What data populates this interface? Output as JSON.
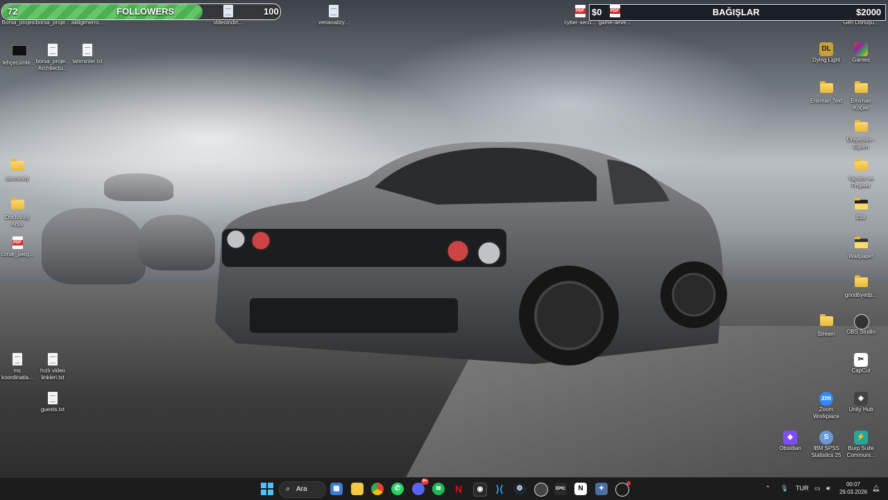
{
  "overlays": {
    "followers": {
      "current": "72",
      "label": "FOLLOWERS",
      "goal": "100",
      "progress": 0.72
    },
    "donations": {
      "current": "$0",
      "label": "BAĞIŞLAR",
      "goal": "$2000"
    }
  },
  "desktop_icons": {
    "borsa_projesi": "Borsa_projesi",
    "borsa_proje": "borsa_proje...",
    "aldigimerro": "aldigimerro...",
    "videoindin": "videoindin...",
    "verianalizy": "verianalizy...",
    "cyber_secu": "cyber-secu...",
    "game_deve": "game-deve...",
    "geri_donusu": "Geri Dönüşü...",
    "lehcecumle": "lehçecümle...",
    "borsa_architectu": "borsa_proje... Architectu...",
    "tahminler": "tahminler.txt",
    "dying_light": "Dying Light",
    "games": "Games",
    "emirhan_text": "Emirhan Text",
    "emirhan_kocak": "Emirhan Koçak",
    "universite": "Üniversite - Eğitim",
    "docminify": "docminify",
    "yazilim": "Yazılım ve Projeler",
    "docminify_arsiv": "DocMinify Arşiv",
    "edit": "Edit",
    "coruk": "coruk_jaleg...",
    "wallpaper": "Wallpaper",
    "goodbyedp": "goodbyedp...",
    "stream": "Stream",
    "obs": "OBS Studio",
    "mc": "mc koordinatla...",
    "hizli": "hızlı video linkleri.txt",
    "capcut": "CapCut",
    "guests": "guests.txt",
    "zoom": "Zoom Workplace",
    "unity": "Unity Hub",
    "obsidian": "Obsidian",
    "ibm": "IBM SPSS Statistics 25",
    "burp": "Burp Suite Communi..."
  },
  "taskbar": {
    "search_label": "Ara",
    "discord_badge": "9+",
    "language": "TUR",
    "time": "00:07",
    "date": "29.03.2026"
  },
  "icon_names": [
    "start-icon",
    "search-icon",
    "store-icon",
    "file-explorer-icon",
    "chrome-icon",
    "whatsapp-icon",
    "discord-icon",
    "spotify-icon",
    "netflix-icon",
    "davinci-icon",
    "vscode-icon",
    "steam-icon",
    "obs-icon",
    "epic-games-icon",
    "notion-icon",
    "app-icon",
    "obs-studio-icon"
  ],
  "colors": {
    "progress_green": "#4caf50",
    "pdf_red": "#d32f2f",
    "folder_yellow": "#ffd96a",
    "taskbar": "#1c1c1c"
  }
}
